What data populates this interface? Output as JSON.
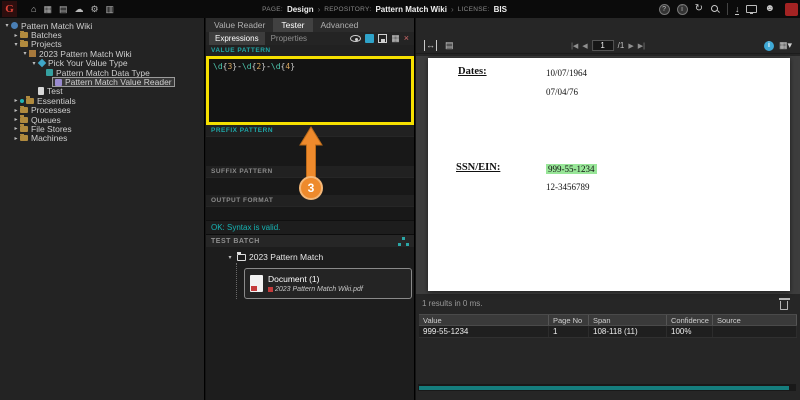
{
  "colors": {
    "accent_teal": "#1fa8a8",
    "highlight_yellow": "#f6e000",
    "annotation_orange": "#ee8a2c",
    "match_green": "#98e698",
    "logo_red": "#e04438"
  },
  "topbar": {
    "logo": "G",
    "breadcrumb": [
      {
        "label": "PAGE:",
        "value": "Design"
      },
      {
        "label": "REPOSITORY:",
        "value": "Pattern Match Wiki"
      },
      {
        "label": "LICENSE:",
        "value": "BIS"
      }
    ]
  },
  "sidebar": {
    "items": [
      {
        "label": "Pattern Match Wiki"
      },
      {
        "label": "Batches"
      },
      {
        "label": "Projects"
      },
      {
        "label": "2023 Pattern Match Wiki"
      },
      {
        "label": "Pick Your Value Type"
      },
      {
        "label": "Pattern Match Data Type"
      },
      {
        "label": "Pattern Match Value Reader"
      },
      {
        "label": "Test"
      },
      {
        "label": "Essentials"
      },
      {
        "label": "Processes"
      },
      {
        "label": "Queues"
      },
      {
        "label": "File Stores"
      },
      {
        "label": "Machines"
      }
    ]
  },
  "center": {
    "tabs": [
      "Value Reader",
      "Tester",
      "Advanced"
    ],
    "subtabs": [
      "Expressions",
      "Properties"
    ],
    "sections": {
      "value_pattern": "VALUE PATTERN",
      "prefix_pattern": "PREFIX PATTERN",
      "suffix_pattern": "SUFFIX PATTERN",
      "output_format": "OUTPUT FORMAT"
    },
    "pattern_tokens": [
      "\\d",
      "{",
      "3",
      "}",
      "-",
      "\\d",
      "{",
      "2",
      "}",
      "-",
      "\\d",
      "{",
      "4",
      "}"
    ],
    "status": "OK: Syntax is valid.",
    "test_batch": {
      "header": "TEST BATCH",
      "folder": "2023 Pattern Match",
      "doc_title": "Document (1)",
      "doc_file": "2023 Pattern Match Wiki.pdf"
    },
    "annotation_step": "3"
  },
  "viewer": {
    "nav": {
      "page": "1",
      "total": "/1"
    },
    "doc": {
      "dates_label": "Dates:",
      "date_values": [
        "10/07/1964",
        "07/04/76"
      ],
      "ssn_label": "SSN/EIN:",
      "ssn_match": "999-55-1234",
      "ssn_other": "12-3456789"
    },
    "results_status": "1 results in 0 ms.",
    "table": {
      "columns": [
        "Value",
        "Page No",
        "Span",
        "Confidence",
        "Source"
      ],
      "rows": [
        {
          "value": "999-55-1234",
          "page": "1",
          "span": "108-118 (11)",
          "confidence": "100%",
          "source": ""
        }
      ]
    }
  }
}
